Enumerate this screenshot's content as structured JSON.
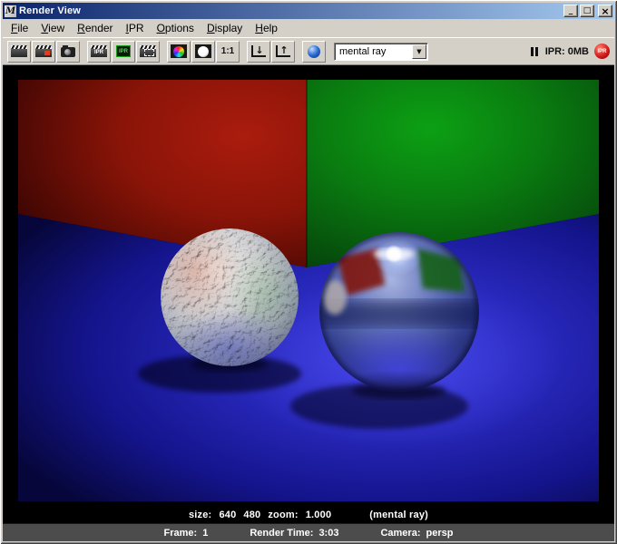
{
  "window": {
    "title": "Render View",
    "icon_glyph": "M",
    "titlebar_gradient": [
      "#0a246a",
      "#a6caf0"
    ],
    "buttons": {
      "minimize": "_",
      "maximize": "□",
      "close": "×"
    }
  },
  "menus": [
    "File",
    "View",
    "Render",
    "IPR",
    "Options",
    "Display",
    "Help"
  ],
  "toolbar": {
    "icons": [
      "render-current-frame-icon",
      "redo-previous-render-icon",
      "snapshot-icon",
      "ipr-render-icon",
      "ipr-refresh-icon",
      "region-render-icon",
      "rgb-channels-icon",
      "alpha-channel-icon",
      "actual-size-icon",
      "keep-image-icon",
      "remove-image-icon",
      "render-settings-icon"
    ],
    "ipr_clap_label": "IPR",
    "ipr_refresh_label": "IPR",
    "scale_label": "1:1",
    "keep_arrow": "↓",
    "remove_arrow": "↑",
    "dropdown_value": "mental ray",
    "dropdown_arrow": "▼",
    "ipr_memory": "IPR: 0MB",
    "ipr_badge_label": "IPR"
  },
  "status": {
    "size_label": "size:",
    "image_width": "640",
    "image_height": "480",
    "zoom_label": "zoom:",
    "zoom_value": "1.000",
    "renderer_note": "(mental ray)",
    "frame_label": "Frame:",
    "frame_value": "1",
    "render_time_label": "Render Time:",
    "render_time_value": "3:03",
    "camera_label": "Camera:",
    "camera_value": "persp"
  },
  "scene": {
    "description": "Cornell-box style render: red left wall, green right wall, blue floor, textured stucco sphere and reflective chrome sphere",
    "left_wall_color": "#8a1408",
    "right_wall_color": "#0a7c10",
    "floor_color": "#2828bc",
    "objects": [
      "stucco-sphere",
      "chrome-sphere"
    ]
  }
}
